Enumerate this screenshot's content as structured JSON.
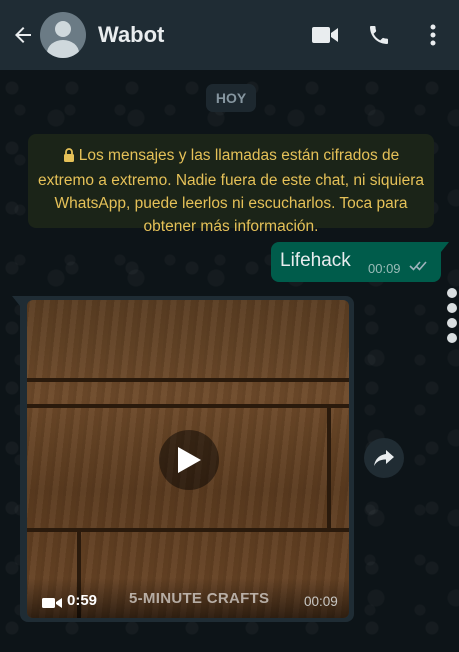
{
  "header": {
    "contact_name": "Wabot",
    "icons": [
      "back-arrow-icon",
      "avatar",
      "video-call-icon",
      "phone-icon",
      "more-options-icon"
    ]
  },
  "chat": {
    "day_label": "HOY",
    "encryption_notice": "Los mensajes y las llamadas están cifrados de extremo a extremo. Nadie fuera de este chat, ni siquiera WhatsApp, puede leerlos ni escucharlos. Toca para obtener más información.",
    "messages": [
      {
        "direction": "outgoing",
        "text": "Lifehack",
        "time": "00:09",
        "status": "read"
      },
      {
        "direction": "incoming",
        "type": "video",
        "duration": "0:59",
        "watermark": "5-MINUTE CRAFTS",
        "time": "00:09"
      }
    ]
  },
  "colors": {
    "header_bg": "#1f2c34",
    "chat_bg": "#0d1418",
    "outgoing_bubble": "#005c4b",
    "incoming_bubble": "#1f2c34",
    "notice_text": "#e5c158",
    "read_ticks": "#8696a0"
  }
}
